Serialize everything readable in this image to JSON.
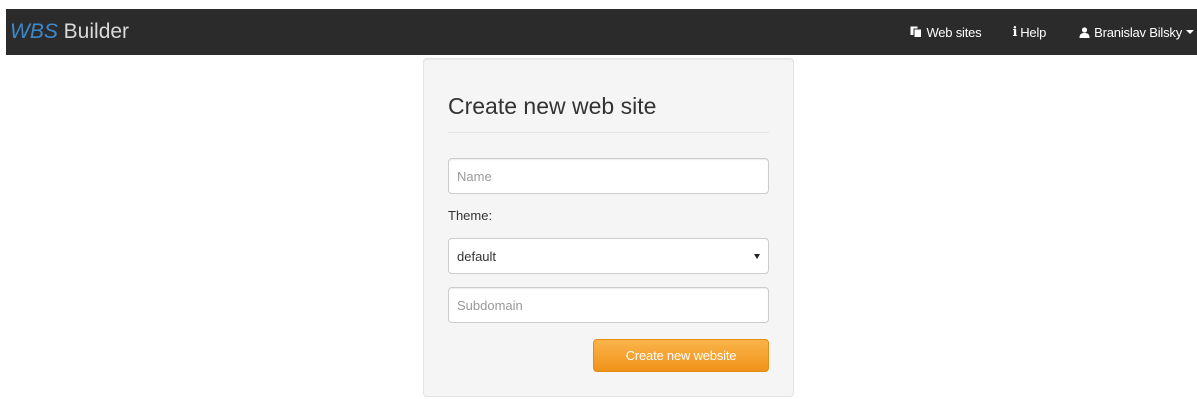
{
  "navbar": {
    "brand_accent": "WBS",
    "brand_rest": " Builder",
    "items": [
      {
        "label": "Web sites",
        "icon": "copy-icon"
      },
      {
        "label": "Help",
        "icon": "info-icon"
      },
      {
        "label": "Branislav Bilsky",
        "icon": "user-icon"
      }
    ]
  },
  "form": {
    "title": "Create new web site",
    "name_placeholder": "Name",
    "theme_label": "Theme:",
    "theme_selected": "default",
    "subdomain_placeholder": "Subdomain",
    "submit_label": "Create new website"
  },
  "colors": {
    "navbar_bg": "#2b2b2b",
    "brand_accent": "#3d88c9",
    "button_orange": "#f0921a"
  }
}
